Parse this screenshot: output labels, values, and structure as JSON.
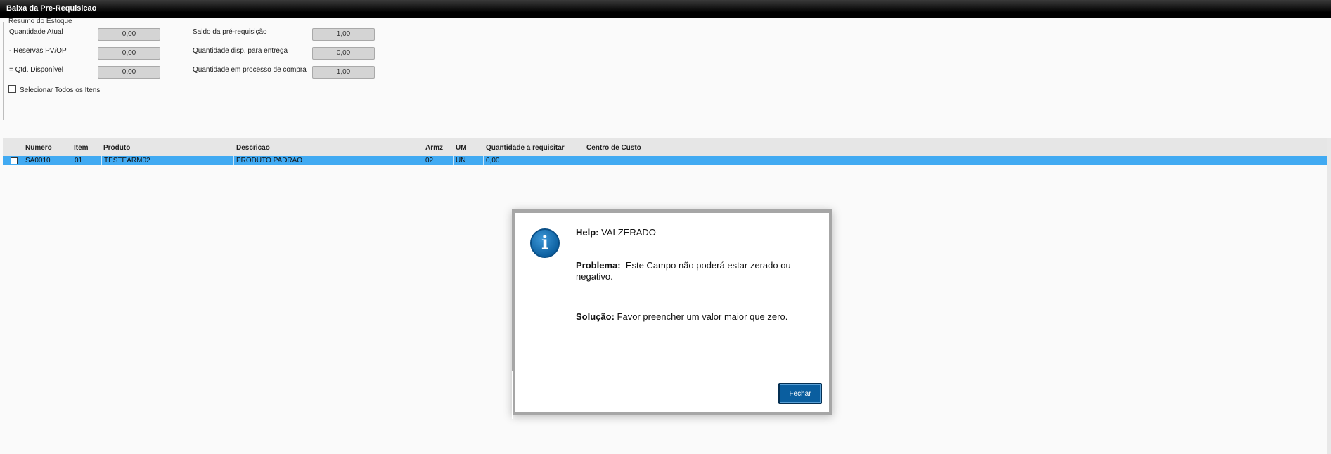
{
  "window": {
    "title": "Baixa da Pre-Requisicao"
  },
  "summary": {
    "legend": "Resumo do Estoque",
    "left_fields": [
      {
        "label": "Quantidade Atual",
        "value": "0,00"
      },
      {
        "label": "- Reservas PV/OP",
        "value": "0,00"
      },
      {
        "label": "= Qtd. Disponível",
        "value": "0,00"
      }
    ],
    "right_fields": [
      {
        "label": "Saldo da pré-requisição",
        "value": "1,00"
      },
      {
        "label": "Quantidade disp. para entrega",
        "value": "0,00"
      },
      {
        "label": "Quantidade em processo de compra",
        "value": "1,00"
      }
    ],
    "select_all_label": "Selecionar Todos os Itens"
  },
  "grid": {
    "columns": [
      "Numero",
      "Item",
      "Produto",
      "Descricao",
      "Armz",
      "UM",
      "Quantidade a requisitar",
      "Centro de Custo"
    ],
    "rows": [
      {
        "cells": [
          "SA0010",
          "01",
          "TESTEARM02",
          "PRODUTO PADRAO",
          "02",
          "UN",
          "0,00",
          ""
        ]
      }
    ]
  },
  "dialog": {
    "help_label": "Help:",
    "help_value": "VALZERADO",
    "problem_label": "Problema:",
    "problem_line1": "Este Campo não poderá estar zerado ou",
    "problem_line2": "negativo.",
    "solution_label": "Solução:",
    "solution_text": "Favor preencher um valor maior que zero.",
    "icon": "info-icon",
    "close_label": "Fechar"
  }
}
